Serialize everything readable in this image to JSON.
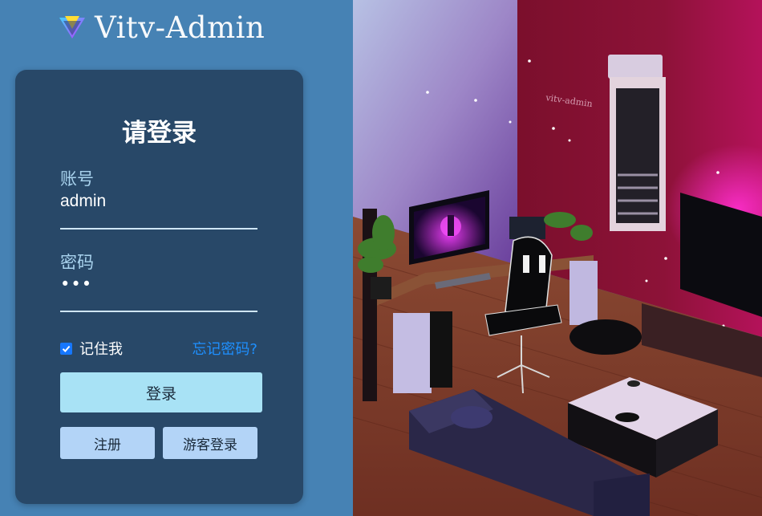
{
  "brand": {
    "name": "Vitv-Admin",
    "logo_icon": "vite-logo-icon"
  },
  "login": {
    "title": "请登录",
    "account_label": "账号",
    "account_value": "admin",
    "password_label": "密码",
    "password_value": "•••",
    "remember_label": "记住我",
    "remember_checked": true,
    "forgot_label": "忘记密码?",
    "login_button": "登录",
    "register_button": "注册",
    "guest_button": "游客登录"
  },
  "illustration": {
    "wall_sign": "vitv-admin"
  },
  "colors": {
    "page_bg": "#4682b4",
    "card_bg": "#284868",
    "accent": "#1677ff",
    "link": "#1e90ff",
    "login_button_bg": "#a8e2f5",
    "secondary_button_bg": "#b3d4f7"
  }
}
